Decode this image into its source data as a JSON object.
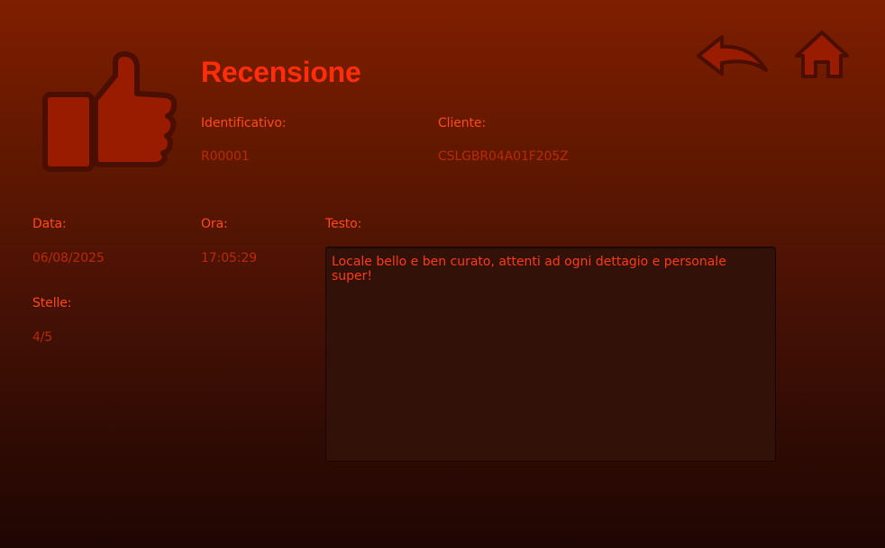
{
  "header": {
    "title": "Recensione",
    "icons": {
      "main": "thumbs-up-icon",
      "back": "back-arrow-icon",
      "home": "home-icon"
    }
  },
  "fields": {
    "identificativo": {
      "label": "Identificativo:",
      "value": "R00001"
    },
    "cliente": {
      "label": "Cliente:",
      "value": "CSLGBR04A01F205Z"
    },
    "data": {
      "label": "Data:",
      "value": "06/08/2025"
    },
    "ora": {
      "label": "Ora:",
      "value": "17:05:29"
    },
    "stelle": {
      "label": "Stelle:",
      "value": "4/5"
    },
    "testo": {
      "label": "Testo:",
      "value": "Locale bello e ben curato, attenti ad ogni dettagio e personale super!"
    }
  },
  "colors": {
    "accent": "#ff2d0a",
    "label": "#ff4a17",
    "value": "#b92a06",
    "icon_fill": "#9a1c00",
    "icon_stroke": "#4a0e02"
  }
}
